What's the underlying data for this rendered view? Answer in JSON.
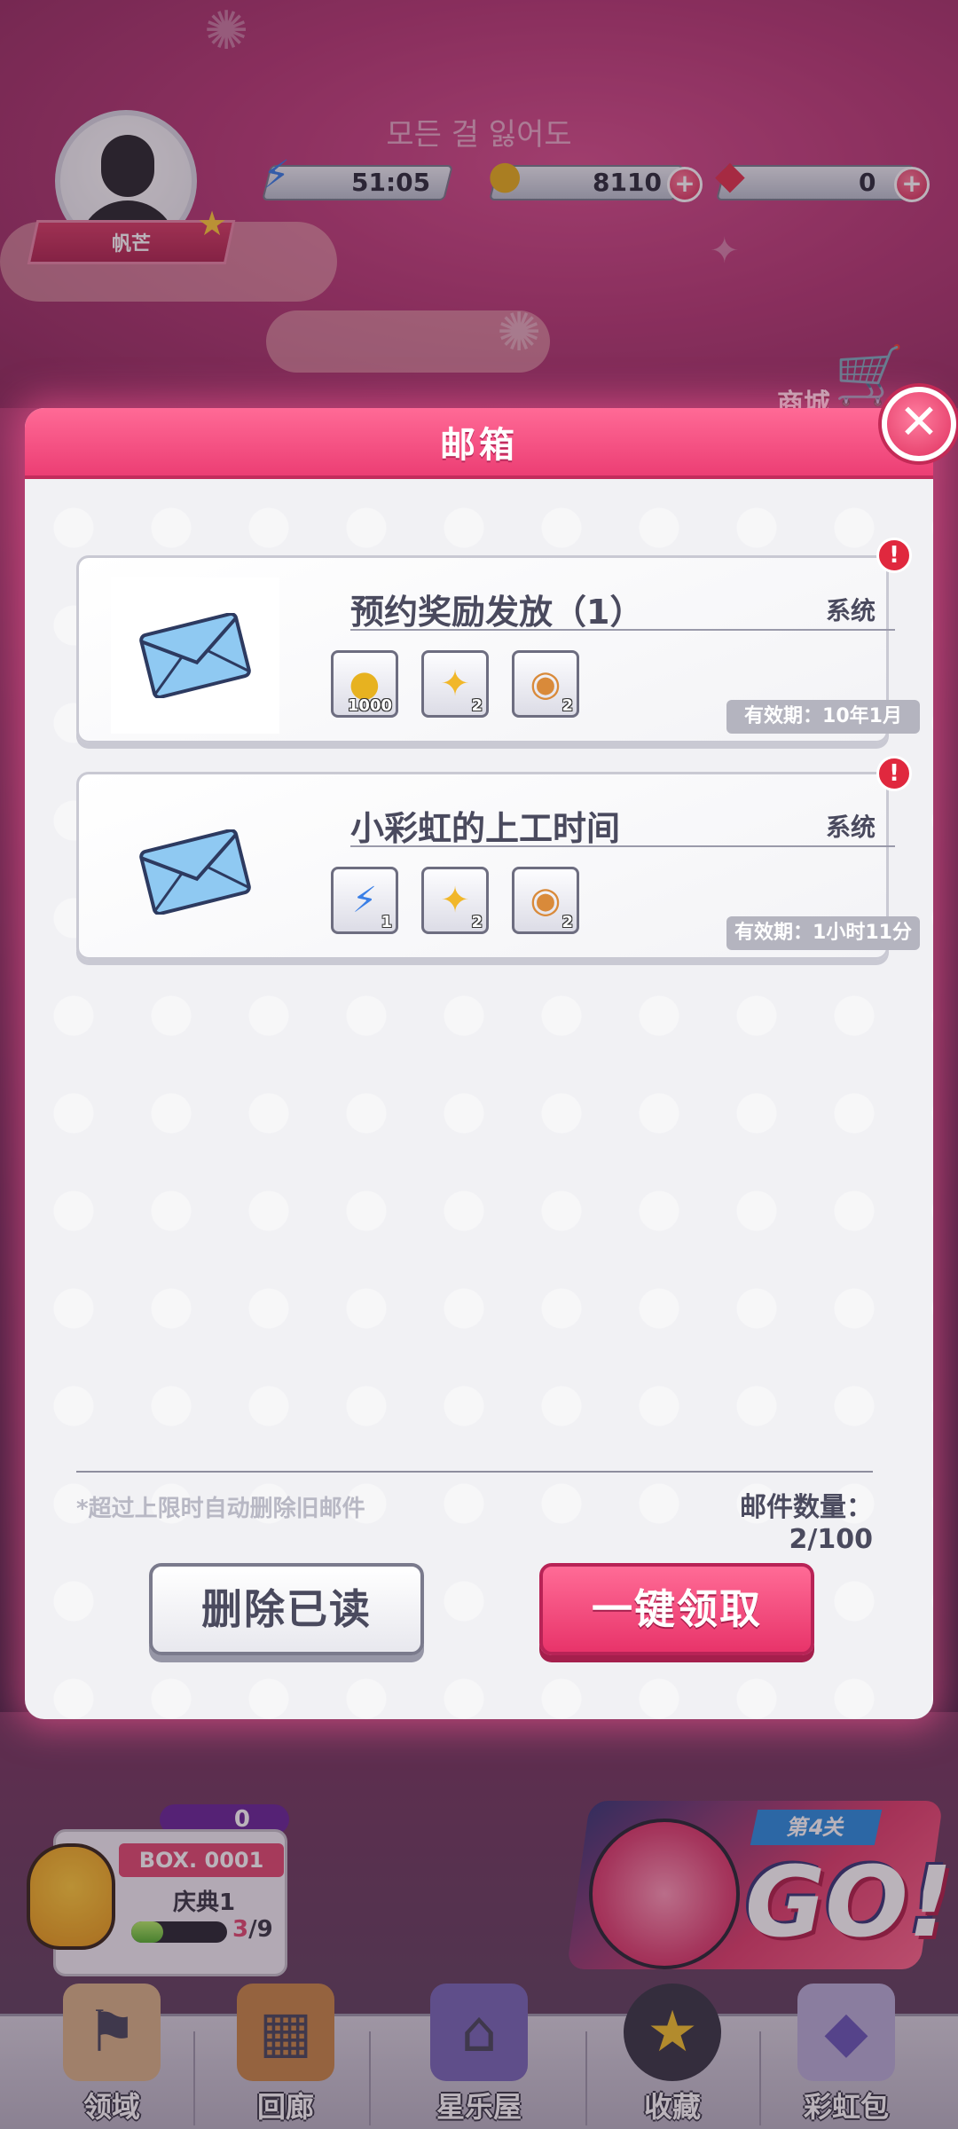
{
  "hud": {
    "player_name": "帆芒",
    "player_title": "모든 걸 잃어도",
    "stamina": "51:05",
    "coins": "8110",
    "gems": "0",
    "shop_label": "商城",
    "plus": "+"
  },
  "mailbox": {
    "title": "邮箱",
    "close": "✕",
    "mails": [
      {
        "title": "预约奖励发放（1）",
        "sender": "系统",
        "rewards": [
          {
            "icon": "gold-coin",
            "count": "1000"
          },
          {
            "icon": "gold-fragments",
            "count": "2"
          },
          {
            "icon": "warrior-medal",
            "count": "2"
          }
        ],
        "expiry": "有效期：10年1月",
        "unread_marker": "!"
      },
      {
        "title": "小彩虹的上工时间",
        "sender": "系统",
        "rewards": [
          {
            "icon": "lightning-stamina",
            "count": "1"
          },
          {
            "icon": "gold-fragments",
            "count": "2"
          },
          {
            "icon": "warrior-medal",
            "count": "2"
          }
        ],
        "expiry": "有效期：1小时11分",
        "unread_marker": "!"
      }
    ],
    "auto_delete_note": "*超过上限时自动删除旧邮件",
    "mail_count": "邮件数量：2/100",
    "delete_read_label": "删除已读",
    "claim_all_label": "一键领取"
  },
  "event": {
    "token_count": "0",
    "box_title": "BOX. 0001",
    "box_sub": "庆典1",
    "progress_current": "3",
    "progress_total": "/9",
    "progress_fraction": 0.33,
    "level_tag": "第4关",
    "go_label": "GO!"
  },
  "bottom_nav": [
    {
      "label": "领域",
      "icon": "arena-icon"
    },
    {
      "label": "回廊",
      "icon": "gallery-icon"
    },
    {
      "label": "星乐屋",
      "icon": "house-icon"
    },
    {
      "label": "收藏",
      "icon": "star-icon"
    },
    {
      "label": "彩虹包",
      "icon": "gem-bag-icon"
    }
  ],
  "colors": {
    "accent_pink": "#ec3e74",
    "unread_red": "#e0283e",
    "expiry_gray": "#b4b4bf"
  }
}
